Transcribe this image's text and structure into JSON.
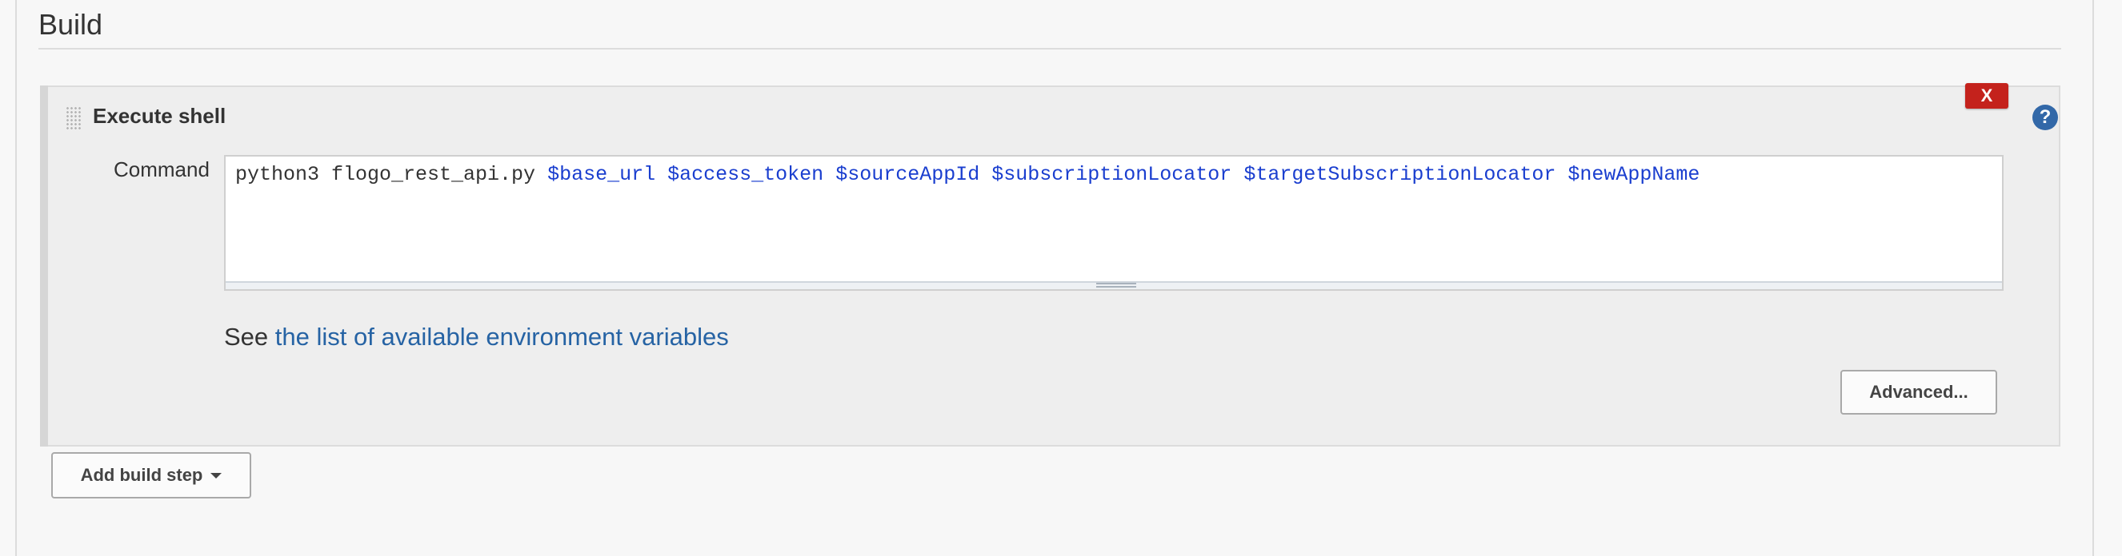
{
  "section": {
    "title": "Build"
  },
  "step": {
    "title": "Execute shell",
    "delete_label": "X",
    "help_label": "?",
    "command_label": "Command",
    "command": {
      "prefix": "python3 flogo_rest_api.py ",
      "vars": [
        "$base_url",
        "$access_token",
        "$sourceAppId",
        "$subscriptionLocator",
        "$targetSubscriptionLocator",
        "$newAppName"
      ]
    },
    "see_prefix": "See ",
    "env_link": "the list of available environment variables",
    "advanced_label": "Advanced..."
  },
  "add_step": {
    "label": "Add build step"
  },
  "colors": {
    "delete": "#c4221c",
    "help": "#3268a8",
    "link": "#2663a4",
    "command_var": "#1a3ecf"
  }
}
